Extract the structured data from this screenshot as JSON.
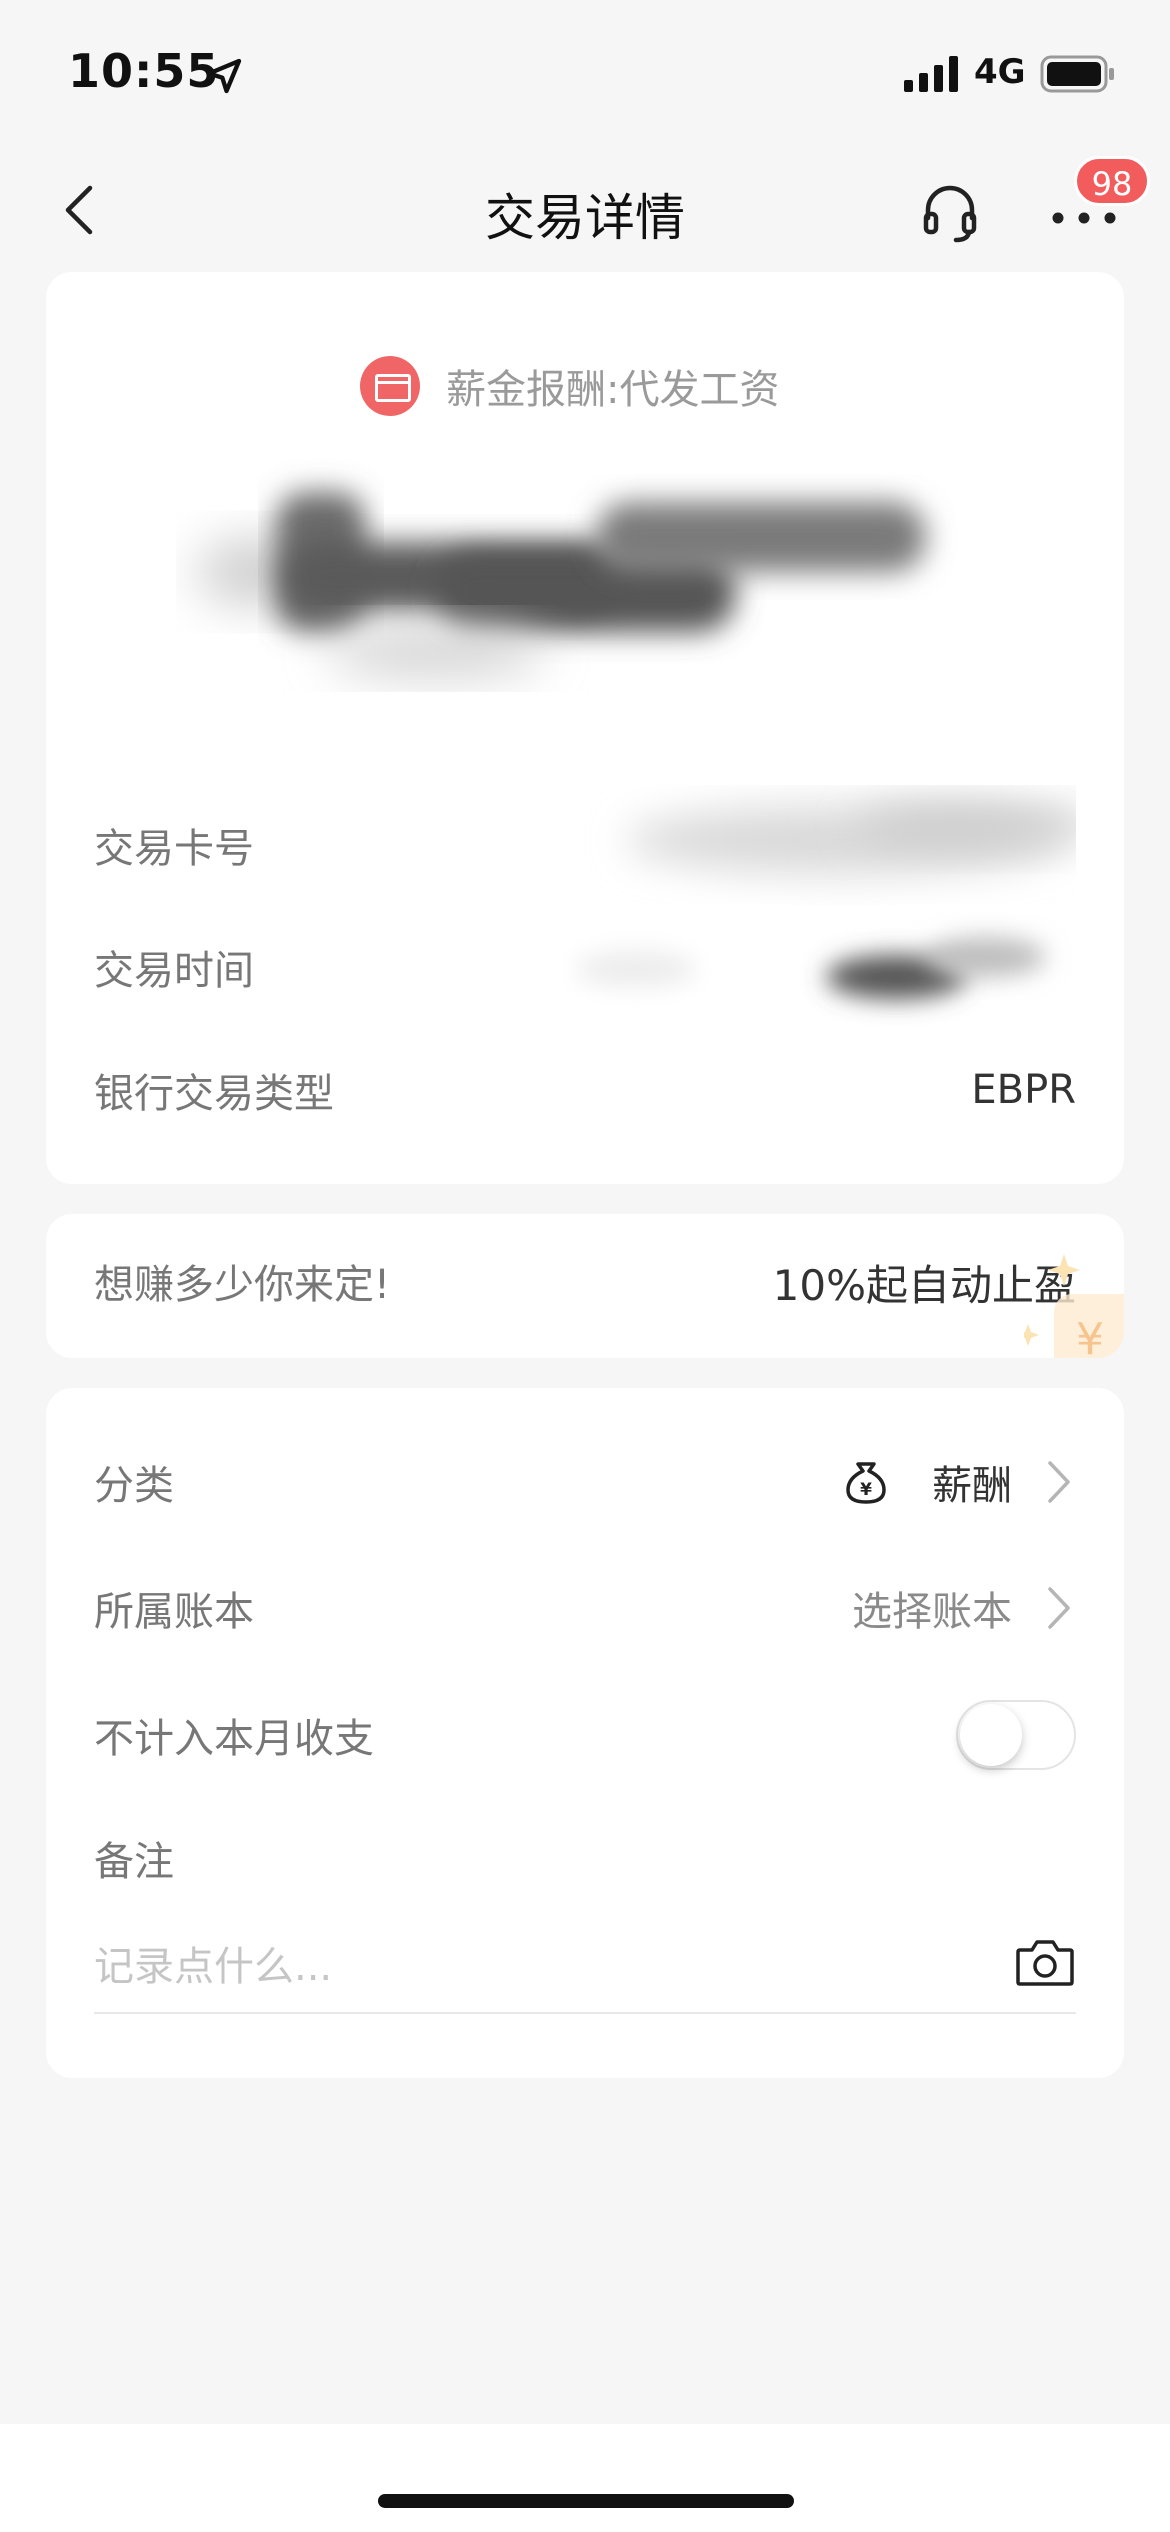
{
  "status_bar": {
    "time": "10:55",
    "network": "4G",
    "icons": [
      "location-arrow-icon",
      "signal-icon",
      "battery-icon"
    ]
  },
  "nav": {
    "title": "交易详情",
    "badge_count": "98",
    "icons": [
      "chevron-left-icon",
      "headset-icon",
      "more-icon"
    ]
  },
  "transaction": {
    "merchant": "薪金报酬:代发工资",
    "rows": [
      {
        "label": "交易卡号"
      },
      {
        "label": "交易时间"
      },
      {
        "label": "银行交易类型",
        "value": "EBPR"
      }
    ]
  },
  "promo": {
    "left_text": "想赚多少你来定!",
    "right_text": "10%起自动止盈"
  },
  "settings": {
    "category_label": "分类",
    "category_value": "薪酬",
    "book_label": "所属账本",
    "book_value": "选择账本",
    "exclude_label": "不计入本月收支",
    "exclude_enabled": false,
    "note_label": "备注",
    "note_placeholder": "记录点什么..."
  },
  "colors": {
    "accent_red": "#f25c5c",
    "background": "#f6f6f6"
  }
}
